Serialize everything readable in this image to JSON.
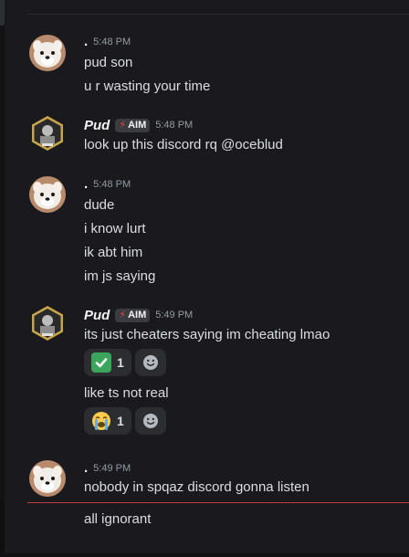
{
  "messages": [
    {
      "author": ".",
      "time": "5:48 PM",
      "lines": [
        "pud son",
        "u r wasting your time"
      ]
    },
    {
      "author": "Pud",
      "tag": "AIM",
      "time": "5:48 PM",
      "lines": [
        "look up this discord rq @oceblud"
      ]
    },
    {
      "author": ".",
      "time": "5:48 PM",
      "lines": [
        "dude",
        "i know lurt",
        "ik abt him",
        "im js saying"
      ]
    },
    {
      "author": "Pud",
      "tag": "AIM",
      "time": "5:49 PM",
      "line1": "its just cheaters saying im cheating lmao",
      "reaction1": {
        "emoji": "white-check-mark",
        "count": "1"
      },
      "line2": "like ts not real",
      "reaction2": {
        "emoji": "loudly-crying-face",
        "count": "1"
      }
    },
    {
      "author": ".",
      "time": "5:49 PM",
      "lines": [
        "nobody in spqaz discord gonna listen",
        "all ignorant"
      ]
    }
  ],
  "colors": {
    "background": "#1a1a1e",
    "text": "#dbdee1",
    "timestamp": "#949ba4",
    "new_messages_divider": "#c33c3f",
    "tag_bolt": "#f23f43"
  }
}
